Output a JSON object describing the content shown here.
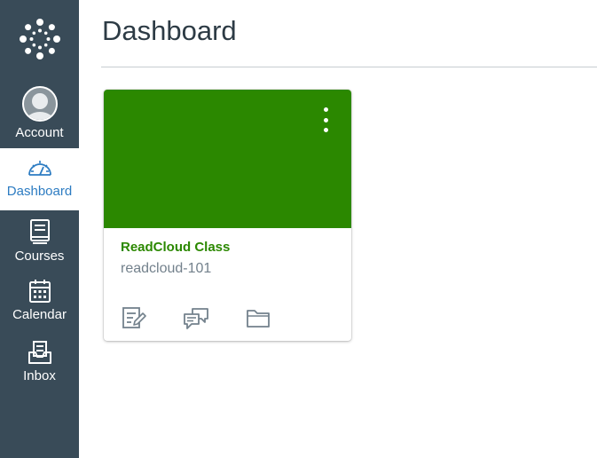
{
  "page": {
    "title": "Dashboard"
  },
  "sidebar": {
    "items": [
      {
        "label": "Account",
        "icon": "avatar"
      },
      {
        "label": "Dashboard",
        "icon": "dashboard-icon",
        "active": true
      },
      {
        "label": "Courses",
        "icon": "courses-icon"
      },
      {
        "label": "Calendar",
        "icon": "calendar-icon"
      },
      {
        "label": "Inbox",
        "icon": "inbox-icon"
      }
    ]
  },
  "course_card": {
    "title": "ReadCloud Class",
    "code": "readcloud-101",
    "color": "#2b8800",
    "actions": [
      {
        "icon": "assignments-icon"
      },
      {
        "icon": "discussions-icon"
      },
      {
        "icon": "files-icon"
      }
    ]
  },
  "colors": {
    "sidebar_bg": "#394b58",
    "active_text": "#2d7cc2",
    "card_hero": "#2b8800"
  }
}
